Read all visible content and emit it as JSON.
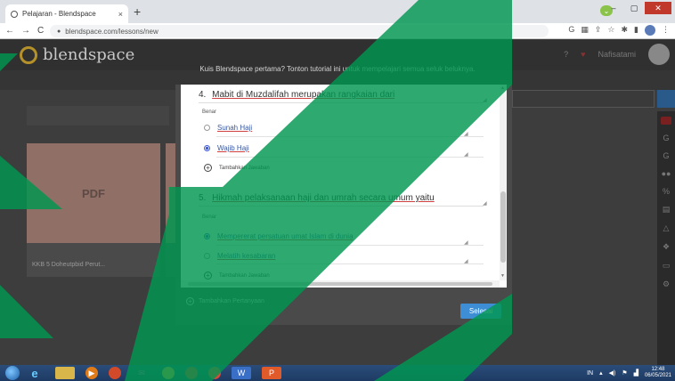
{
  "browser": {
    "tab_title": "Pelajaran - Blendspace",
    "tab_close": "×",
    "new_tab": "+",
    "url": "blendspace.com/lessons/new",
    "nav": {
      "back": "←",
      "forward": "→",
      "reload": "C",
      "lock": "🔒"
    }
  },
  "app": {
    "logo_text": "blendspace",
    "tip_text": "Kuis Blendspace pertama? Tonton tutorial ini untuk mempelajari semua seluk beluknya.",
    "card_placeholder": "PDF",
    "card_caption": "KKB 5 Doheutpbid Perut...",
    "username": "Nafisatami"
  },
  "quiz": {
    "questions": [
      {
        "number": "4.",
        "text": "Mabit di Muzdalifah merupakan rangkaian dari",
        "answers_label": "Benar",
        "options": [
          {
            "text": "Sunah Haji",
            "selected": false
          },
          {
            "text": "Wajib Haji",
            "selected": true
          }
        ],
        "add_answer": "Tambahkan Jawaban"
      },
      {
        "number": "5.",
        "text": "Hikmah pelaksanaan haji dan umrah secara umum yaitu",
        "answers_label": "Benar",
        "options": [
          {
            "text": "Mempererat persatuan umat Islam di dunia",
            "selected": true
          },
          {
            "text": "Melatih kesabaran",
            "selected": false
          }
        ],
        "add_answer": "Tambahkan Jawaban"
      }
    ],
    "add_question": "Tambahkan Pertanyaan",
    "done_button": "Selesai"
  },
  "taskbar": {
    "time": "12:48",
    "date": "06/05/2021",
    "lang": "IN"
  },
  "colors": {
    "overlay_green": "#009650",
    "done_blue": "#3e8ed6",
    "radio_blue": "#3b5bdb",
    "spell_underline": "#d04040"
  }
}
